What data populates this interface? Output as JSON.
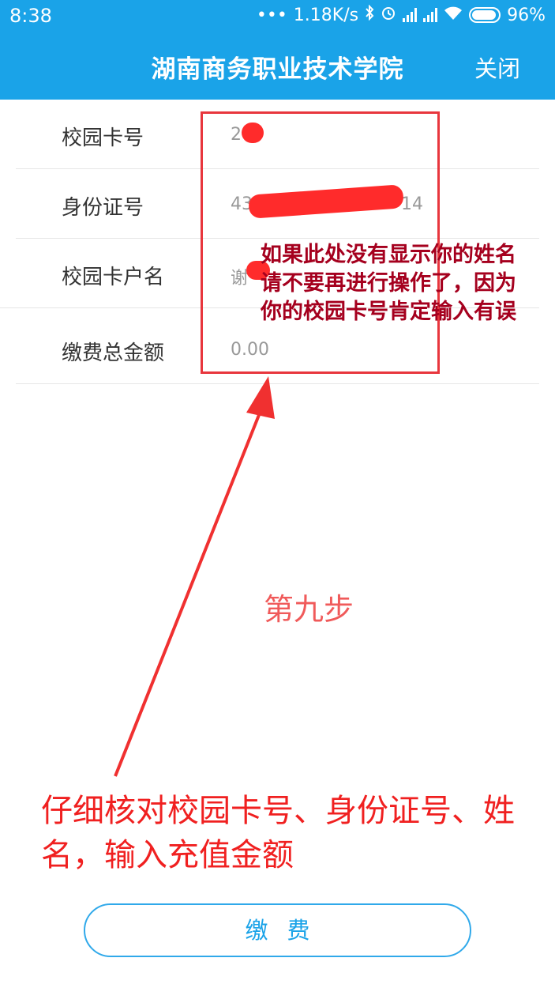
{
  "status_bar": {
    "time": "8:38",
    "dots": "•••",
    "network_speed": "1.18K/s",
    "battery": "96%",
    "icons": [
      "bluetooth-icon",
      "alarm-icon",
      "signal-icon",
      "signal-icon",
      "wifi-icon",
      "battery-icon"
    ]
  },
  "header": {
    "title": "湖南商务职业技术学院",
    "close_label": "关闭"
  },
  "form": {
    "rows": [
      {
        "label": "校园卡号",
        "value": "2"
      },
      {
        "label": "身份证号",
        "value": "43",
        "value_tail": "14"
      },
      {
        "label": "校园卡户名",
        "value": "谢"
      },
      {
        "label": "缴费总金额",
        "value": "0.00"
      }
    ]
  },
  "annotations": {
    "note_lines": [
      "如果此处没有显示你的姓名",
      "请不要再进行操作了，因为",
      "你的校园卡号肯定输入有误"
    ],
    "step": "第九步",
    "instruction": "仔细核对校园卡号、身份证号、姓名，输入充值金额"
  },
  "pay_button": {
    "label": "缴费"
  },
  "colors": {
    "header_bg": "#1aa3e8",
    "annotation_red": "#e8363d",
    "note_text": "#a5001e",
    "button_border": "#30a9ea"
  }
}
